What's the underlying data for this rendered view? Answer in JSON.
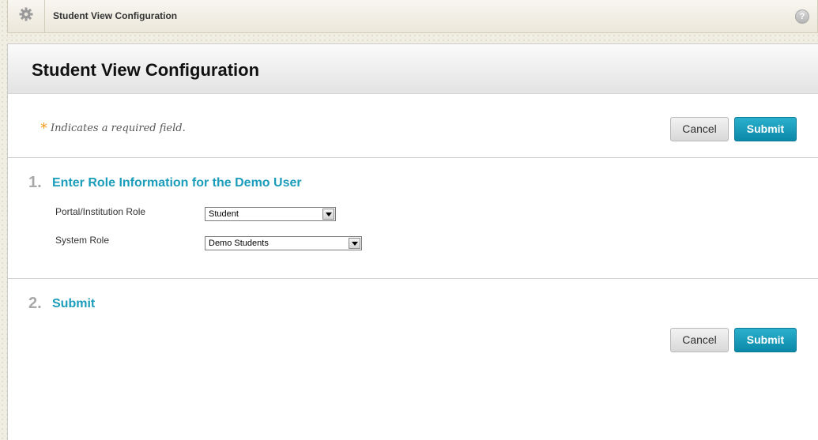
{
  "breadcrumb": {
    "icon": "gear-icon",
    "title": "Student View Configuration",
    "help_icon": "help-icon",
    "help_glyph": "?"
  },
  "page": {
    "title": "Student View Configuration"
  },
  "required_note": {
    "star": "*",
    "text": "Indicates a required field."
  },
  "buttons": {
    "cancel": "Cancel",
    "submit": "Submit"
  },
  "steps": [
    {
      "number": "1.",
      "title": "Enter Role Information for the Demo User",
      "fields": [
        {
          "label": "Portal/Institution Role",
          "value": "Student"
        },
        {
          "label": "System Role",
          "value": "Demo Students"
        }
      ]
    },
    {
      "number": "2.",
      "title": "Submit"
    }
  ],
  "colors": {
    "accent": "#1a9cbb",
    "submit_button": "#1894b2",
    "required_star": "#f49a1a"
  }
}
